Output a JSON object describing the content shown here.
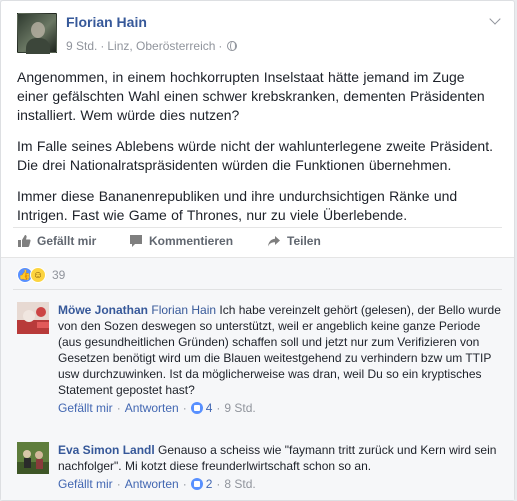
{
  "post": {
    "author": "Florian Hain",
    "time": "9 Std.",
    "location": "Linz, Oberösterreich",
    "paragraphs": [
      "Angenommen, in einem hochkorrupten Inselstaat hätte jemand im Zuge einer gefälschten Wahl einen schwer krebskranken, dementen Präsidenten installiert. Wem würde dies nutzen?",
      "Im Falle seines Ablebens würde nicht der wahlunterlegene zweite Präsident. Die drei Nationalratspräsidenten würden die Funktionen übernehmen.",
      "Immer diese Bananenrepubliken und ihre undurchsichtigen Ränke und Intrigen. Fast wie Game of Thrones, nur zu viele Überlebende."
    ]
  },
  "actions": {
    "like": "Gefällt mir",
    "comment": "Kommentieren",
    "share": "Teilen"
  },
  "reactions": {
    "count": "39",
    "icons": [
      "like-icon",
      "haha-icon"
    ]
  },
  "comments": [
    {
      "author": "Möwe Jonathan",
      "tag": "Florian Hain",
      "text": "Ich habe vereinzelt gehört (gelesen), der Bello wurde von den Sozen deswegen so unterstützt, weil er angeblich keine ganze Periode (aus gesundheitlichen Gründen) schaffen soll und jetzt nur zum Verifizieren von Gesetzen benötigt wird um die Blauen weitestgehend zu verhindern bzw um TTIP usw durchzuwinken. Ist da möglicherweise was dran, weil Du so ein kryptisches Statement gepostet hast?",
      "like_label": "Gefällt mir",
      "reply_label": "Antworten",
      "likes": "4",
      "time": "9 Std."
    },
    {
      "author": "Eva Simon Landl",
      "tag": "",
      "text": "Genauso a scheiss wie \"faymann tritt zurück und Kern wird sein nachfolger\". Mi kotzt diese freunderlwirtschaft schon so an.",
      "like_label": "Gefällt mir",
      "reply_label": "Antworten",
      "likes": "2",
      "time": "8 Std."
    }
  ],
  "colors": {
    "link": "#365899",
    "meta": "#90949c",
    "like_blue": "#5890ff",
    "background": "#e9ebee"
  }
}
